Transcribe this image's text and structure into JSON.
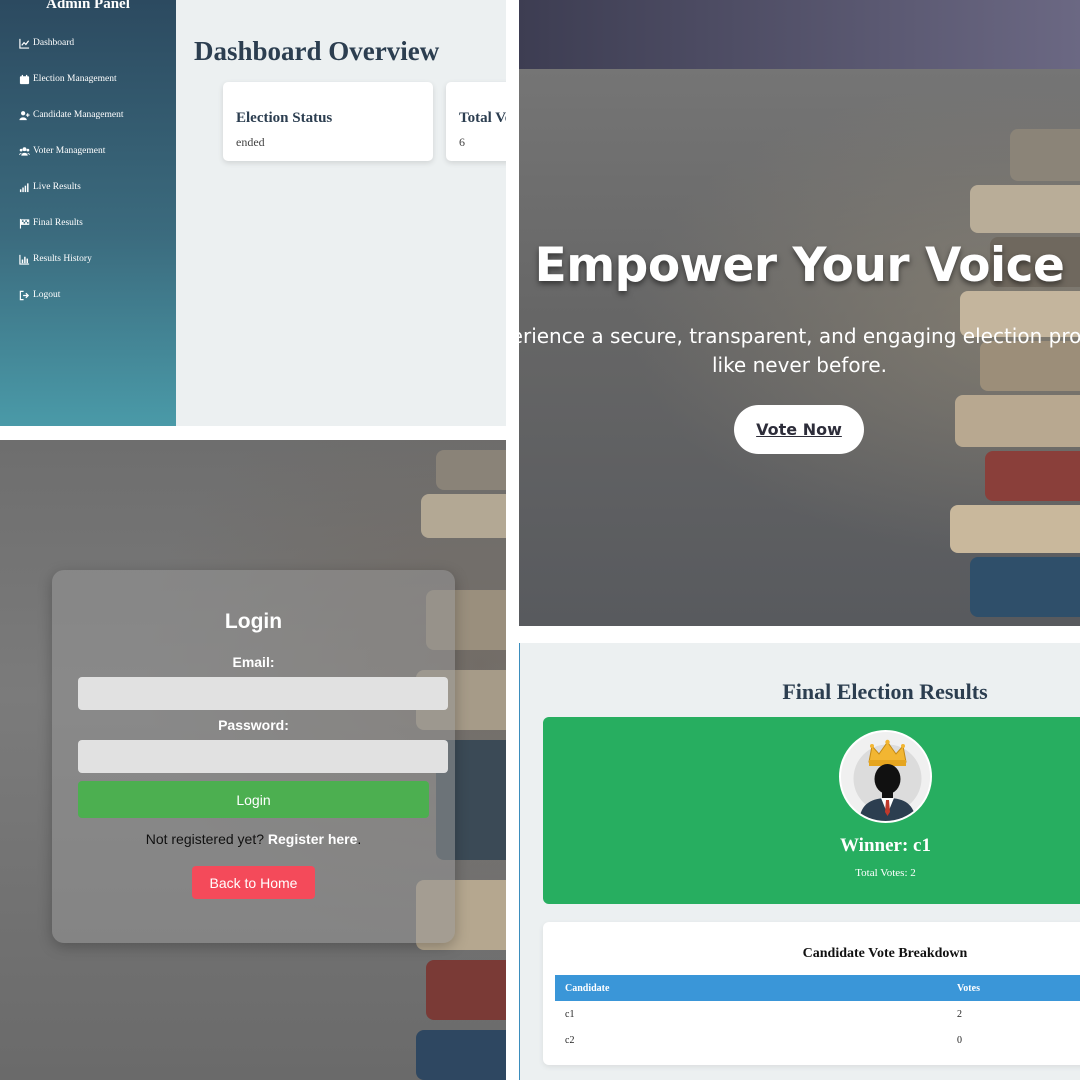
{
  "admin": {
    "sidebar_title": "Admin Panel",
    "nav": [
      {
        "label": "Dashboard",
        "icon": "chart-line-icon"
      },
      {
        "label": "Election Management",
        "icon": "calendar-icon"
      },
      {
        "label": "Candidate Management",
        "icon": "user-plus-icon"
      },
      {
        "label": "Voter Management",
        "icon": "users-icon"
      },
      {
        "label": "Live Results",
        "icon": "signal-bars-icon"
      },
      {
        "label": "Final Results",
        "icon": "flag-checkered-icon"
      },
      {
        "label": "Results History",
        "icon": "chart-bar-icon"
      },
      {
        "label": "Logout",
        "icon": "sign-out-icon"
      }
    ],
    "page_title": "Dashboard Overview",
    "cards": [
      {
        "label": "Election Status",
        "value": "ended"
      },
      {
        "label": "Total Votes",
        "value": "6"
      }
    ]
  },
  "hero": {
    "title": "Empower Your Voice",
    "subtitle_line1": "Experience a secure, transparent, and engaging election process",
    "subtitle_line2": "like never before.",
    "cta": "Vote Now"
  },
  "login": {
    "title": "Login",
    "email_label": "Email:",
    "email_value": "",
    "password_label": "Password:",
    "password_value": "",
    "submit": "Login",
    "register_prompt": "Not registered yet?",
    "register_link": "Register here",
    "register_suffix": ".",
    "back_home": "Back to Home"
  },
  "results": {
    "title": "Final Election Results",
    "winner": "Winner: c1",
    "total_votes": "Total Votes: 2",
    "breakdown_title": "Candidate Vote Breakdown",
    "columns": [
      "Candidate",
      "Votes"
    ],
    "rows": [
      {
        "candidate": "c1",
        "votes": "2"
      },
      {
        "candidate": "c2",
        "votes": "0"
      }
    ]
  },
  "colors": {
    "sidebar_top": "#2c4a60",
    "sidebar_bottom": "#4a9aa8",
    "heading": "#2c3e50",
    "login_button": "#4caf50",
    "home_button": "#f44a5a",
    "winner_card": "#27ae60",
    "table_header": "#3a96d8"
  }
}
